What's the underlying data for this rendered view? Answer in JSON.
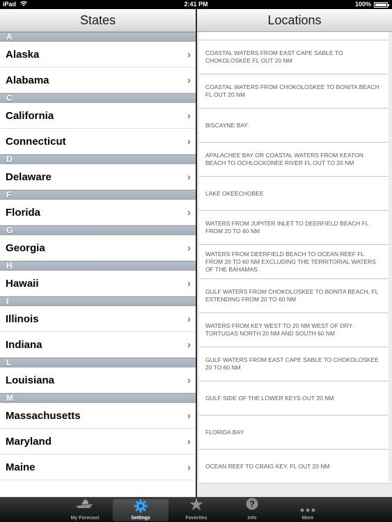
{
  "status_bar": {
    "carrier": "iPad",
    "time": "2:41 PM",
    "battery": "100%"
  },
  "states_pane": {
    "title": "States",
    "sections": [
      {
        "letter": "A",
        "states": [
          "Alaska",
          "Alabama"
        ]
      },
      {
        "letter": "C",
        "states": [
          "California",
          "Connecticut"
        ]
      },
      {
        "letter": "D",
        "states": [
          "Delaware"
        ]
      },
      {
        "letter": "F",
        "states": [
          "Florida"
        ]
      },
      {
        "letter": "G",
        "states": [
          "Georgia"
        ]
      },
      {
        "letter": "H",
        "states": [
          "Hawaii"
        ]
      },
      {
        "letter": "I",
        "states": [
          "Illinois",
          "Indiana"
        ]
      },
      {
        "letter": "L",
        "states": [
          "Louisiana"
        ]
      },
      {
        "letter": "M",
        "states": [
          "Massachusetts",
          "Maryland",
          "Maine"
        ]
      }
    ]
  },
  "locations_pane": {
    "title": "Locations",
    "items": [
      "COASTAL WATERS FROM EAST CAPE SABLE TO CHOKOLOSKEE FL OUT 20 NM",
      "COASTAL WATERS FROM CHOKOLOSKEE TO BONITA BEACH FL OUT 20 NM",
      "BISCAYNE BAY",
      "APALACHEE BAY OR COASTAL WATERS FROM KEATON BEACH TO OCHLOCKONEE RIVER FL OUT TO 20 NM",
      "LAKE OKEECHOBEE",
      "WATERS FROM JUPITER INLET TO DEERFIELD BEACH FL FROM 20 TO 60 NM",
      "WATERS FROM DEERFIELD BEACH TO OCEAN REEF FL FROM 20 TO 60 NM EXCLUDING THE TERRITORIAL WATERS OF THE BAHAMAS",
      "GULF WATERS FROM CHOKOLOSKEE TO BONITA BEACH, FL EXTENDING FROM 20 TO 60 NM",
      "WATERS FROM KEY WEST TO 20 NM WEST OF DRY TORTUGAS NORTH 20 NM AND SOUTH 60 NM",
      "GULF WATERS FROM EAST CAPE SABLE TO CHOKOLOSKEE 20 TO 60 NM",
      "GULF SIDE OF THE LOWER KEYS OUT 20 NM",
      "FLORIDA BAY",
      "OCEAN REEF TO CRAIG KEY, FL OUT 20 NM"
    ]
  },
  "tab_bar": {
    "tabs": [
      {
        "label": "My Forecast",
        "icon": "boat-icon",
        "active": false
      },
      {
        "label": "Settings",
        "icon": "gear-icon",
        "active": true
      },
      {
        "label": "Favorites",
        "icon": "star-icon",
        "active": false
      },
      {
        "label": "Info",
        "icon": "question-icon",
        "active": false
      },
      {
        "label": "More",
        "icon": "more-icon",
        "active": false
      }
    ]
  },
  "colors": {
    "section_header": "#a9b4bf",
    "active_tab_icon": "#2fa6ff",
    "tab_bar": "#1a1a1a"
  }
}
